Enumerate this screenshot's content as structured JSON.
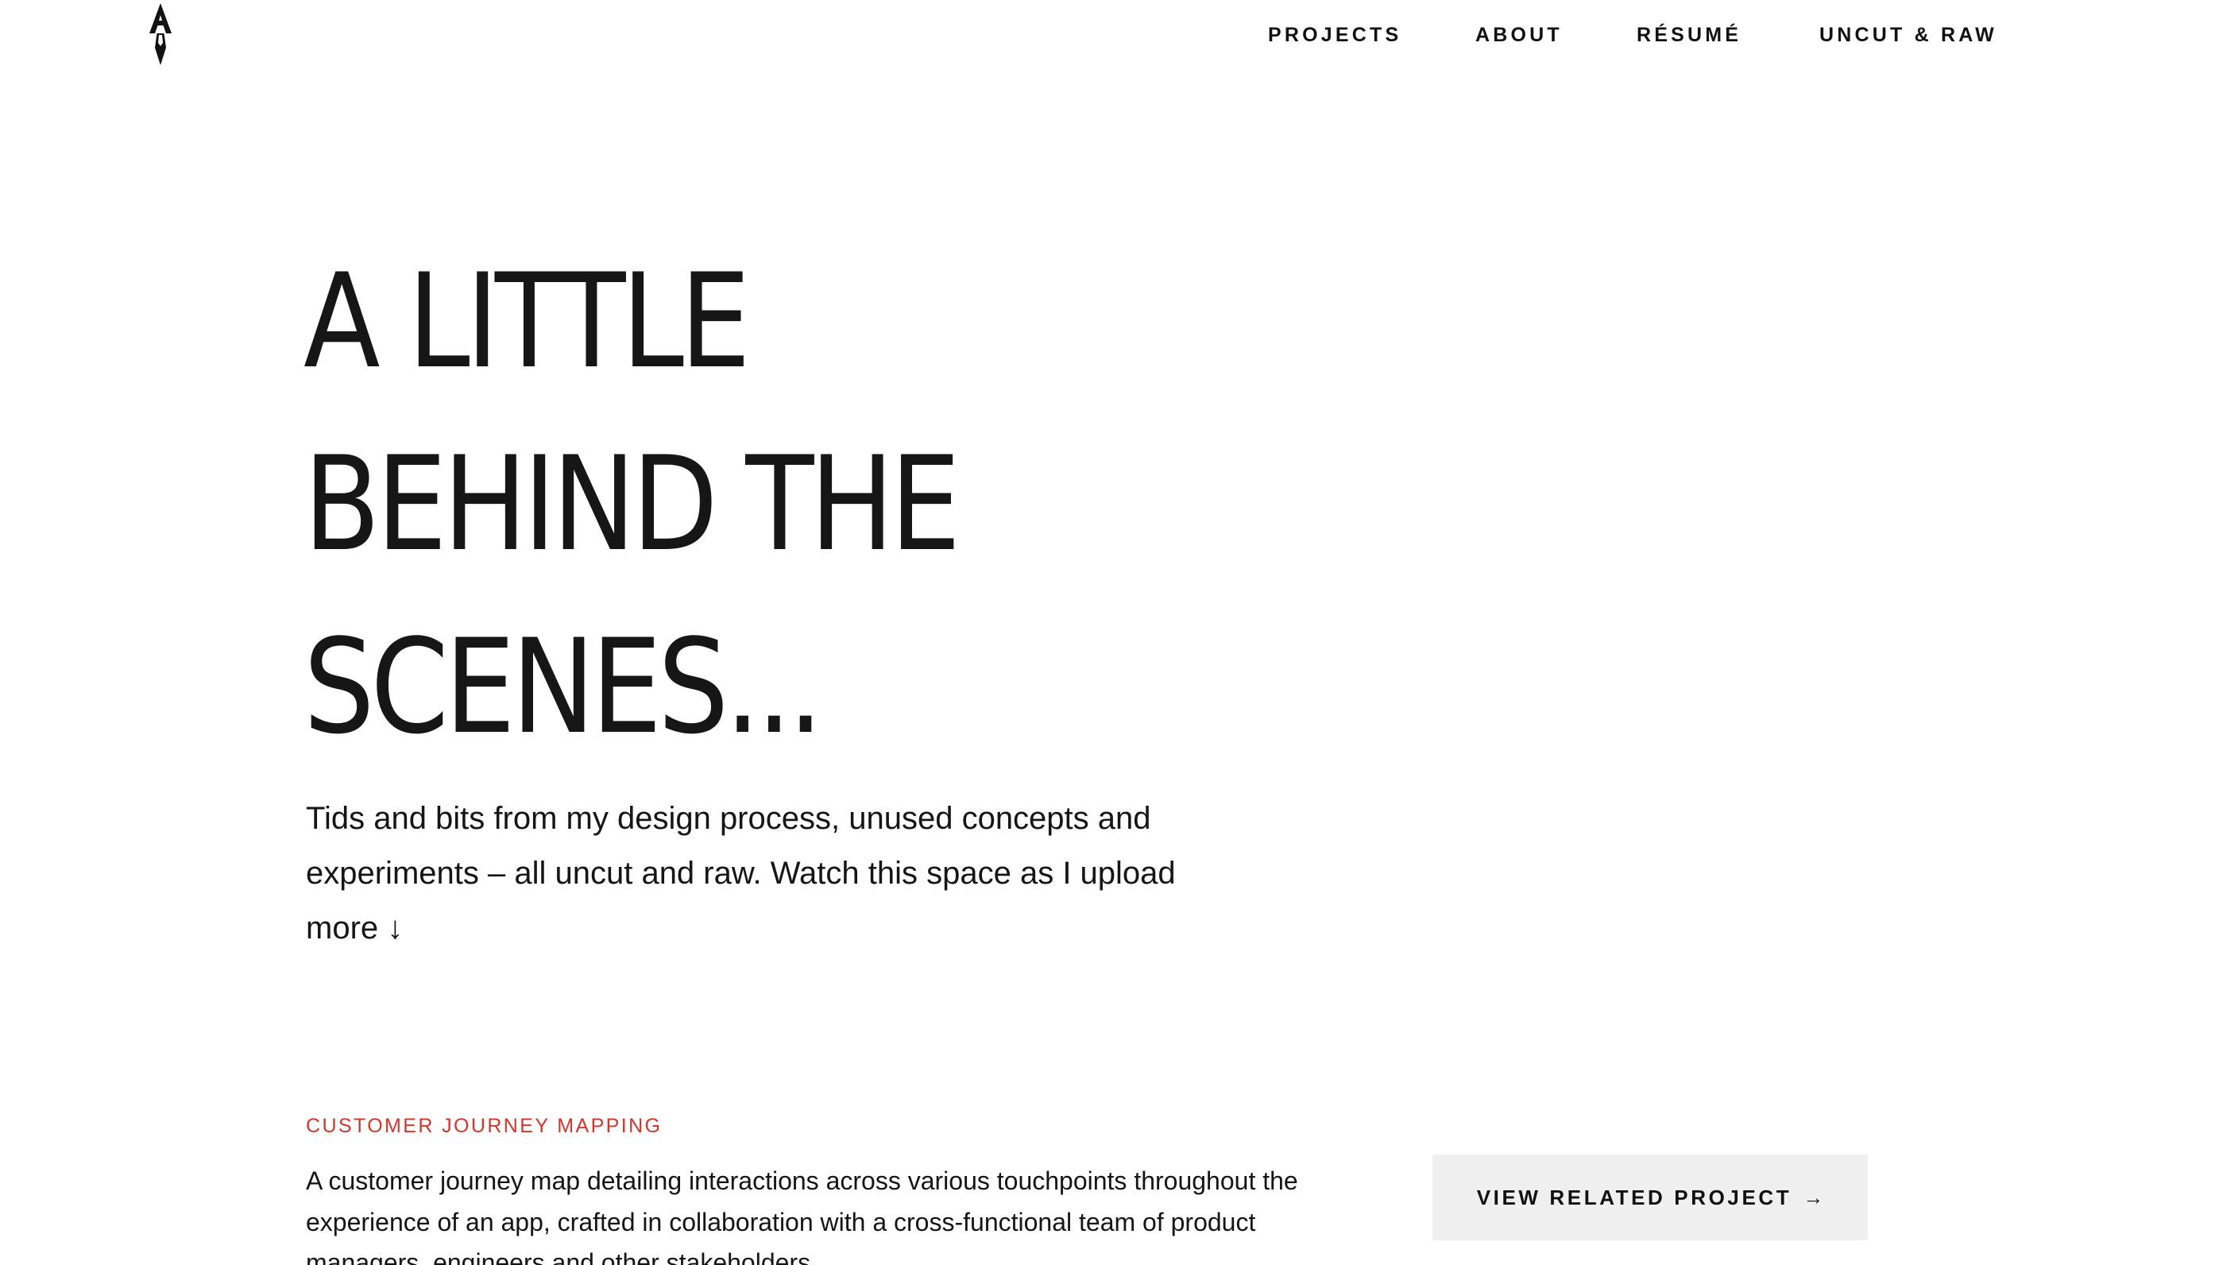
{
  "header": {
    "logo_icon": "monogram-a-logo-icon",
    "nav": {
      "projects": "PROJECTS",
      "about": "ABOUT",
      "resume": "RÉSUMÉ",
      "uncut": "UNCUT & RAW"
    }
  },
  "hero": {
    "title_lines": [
      "A LITTLE",
      "BEHIND THE",
      "SCENES..."
    ],
    "subtitle": "Tids and bits from my design process, unused concepts and experiments – all uncut and raw. Watch this space as I upload more ↓"
  },
  "section": {
    "tag": "CUSTOMER JOURNEY MAPPING",
    "tag_color": "#d0372c",
    "description": "A customer journey map detailing interactions across various touchpoints throughout the experience of an app, crafted in collaboration with a cross-functional team of product managers, engineers and other stakeholders.",
    "button_label": "VIEW RELATED PROJECT",
    "button_icon": "arrow-right-icon",
    "button_arrow": "→"
  }
}
